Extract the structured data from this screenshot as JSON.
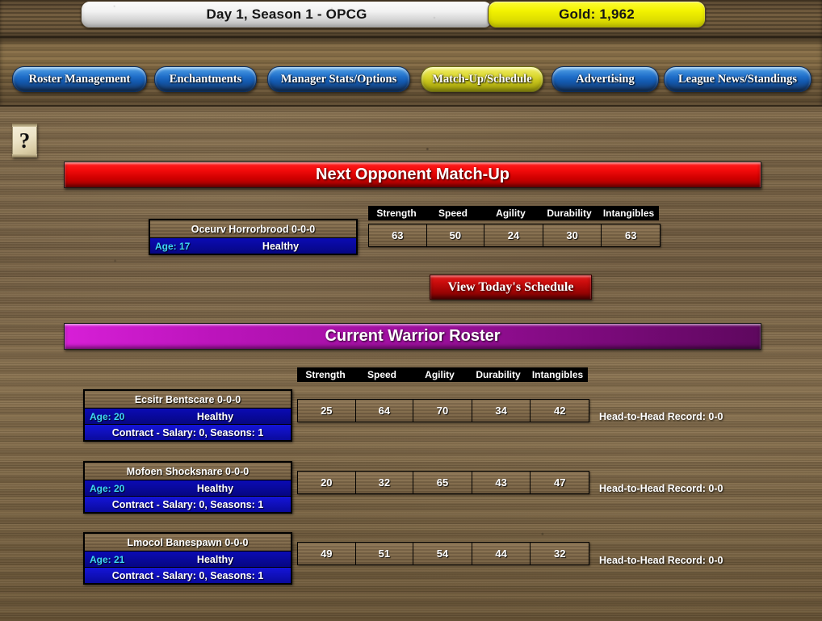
{
  "topbar": {
    "day_season": "Day 1, Season 1 - OPCG",
    "gold": "Gold: 1,962"
  },
  "nav": {
    "items": [
      {
        "label": "Roster Management",
        "active": false
      },
      {
        "label": "Enchantments",
        "active": false
      },
      {
        "label": "Manager Stats/Options",
        "active": false
      },
      {
        "label": "Match-Up/Schedule",
        "active": true
      },
      {
        "label": "Advertising",
        "active": false
      },
      {
        "label": "League News/Standings",
        "active": false
      }
    ]
  },
  "help": {
    "glyph": "?"
  },
  "stat_columns": [
    "Strength",
    "Speed",
    "Agility",
    "Durability",
    "Intangibles"
  ],
  "opponent_section": {
    "banner": "Next Opponent Match-Up",
    "opponent": {
      "name": "Oceurv Horrorbrood  0-0-0",
      "age": "Age: 17",
      "health": "Healthy",
      "stats": [
        "63",
        "50",
        "24",
        "30",
        "63"
      ]
    },
    "schedule_button": "View Today's Schedule"
  },
  "roster_section": {
    "banner": "Current Warrior Roster",
    "players": [
      {
        "name": "Ecsitr Bentscare  0-0-0",
        "age": "Age: 20",
        "health": "Healthy",
        "contract": "Contract - Salary: 0, Seasons: 1",
        "stats": [
          "25",
          "64",
          "70",
          "34",
          "42"
        ],
        "head_to_head": "Head-to-Head Record: 0-0"
      },
      {
        "name": "Mofoen Shocksnare  0-0-0",
        "age": "Age: 20",
        "health": "Healthy",
        "contract": "Contract - Salary: 0, Seasons: 1",
        "stats": [
          "20",
          "32",
          "65",
          "43",
          "47"
        ],
        "head_to_head": "Head-to-Head Record: 0-0"
      },
      {
        "name": "Lmocol Banespawn  0-0-0",
        "age": "Age: 21",
        "health": "Healthy",
        "contract": "Contract - Salary: 0, Seasons: 1",
        "stats": [
          "49",
          "51",
          "54",
          "44",
          "32"
        ],
        "head_to_head": "Head-to-Head Record: 0-0"
      }
    ]
  },
  "colors": {
    "wood": "#7c6647",
    "nav_blue": "#1f6ec9",
    "nav_active_yellow": "#d9d62e",
    "banner_red": "#d00000",
    "banner_purple": "#9b0f9b",
    "card_blue": "#0a0aa8",
    "age_cyan": "#3fd8f5",
    "gold_pill": "#f2f200"
  }
}
